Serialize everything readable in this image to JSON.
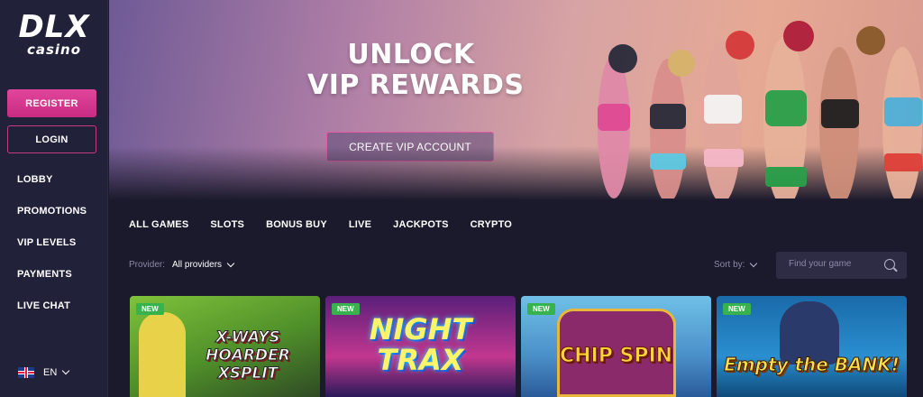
{
  "brand": {
    "name": "DLX",
    "sub": "casino"
  },
  "auth": {
    "register": "REGISTER",
    "login": "LOGIN"
  },
  "nav": [
    {
      "label": "LOBBY"
    },
    {
      "label": "PROMOTIONS"
    },
    {
      "label": "VIP LEVELS"
    },
    {
      "label": "PAYMENTS"
    },
    {
      "label": "LIVE CHAT"
    }
  ],
  "language": {
    "code": "EN",
    "flag_icon": "uk-flag-icon"
  },
  "hero": {
    "line1": "UNLOCK",
    "line2": "VIP REWARDS",
    "cta": "CREATE VIP ACCOUNT"
  },
  "tabs": [
    "ALL GAMES",
    "SLOTS",
    "BONUS BUY",
    "LIVE",
    "JACKPOTS",
    "CRYPTO"
  ],
  "filters": {
    "provider_label": "Provider:",
    "provider_value": "All providers",
    "sort_label": "Sort by:"
  },
  "search": {
    "placeholder": "Find your game",
    "icon": "search-icon"
  },
  "games": [
    {
      "badge": "NEW",
      "title": "X-WAYS HOARDER XSPLIT"
    },
    {
      "badge": "NEW",
      "title": "NIGHT TRAX"
    },
    {
      "badge": "NEW",
      "title": "CHIP SPIN"
    },
    {
      "badge": "NEW",
      "title": "Empty the BANK!"
    }
  ],
  "colors": {
    "accent": "#d63f93",
    "bg": "#1b1a2c",
    "sidebar": "#22213a",
    "new_badge": "#37b24d"
  }
}
